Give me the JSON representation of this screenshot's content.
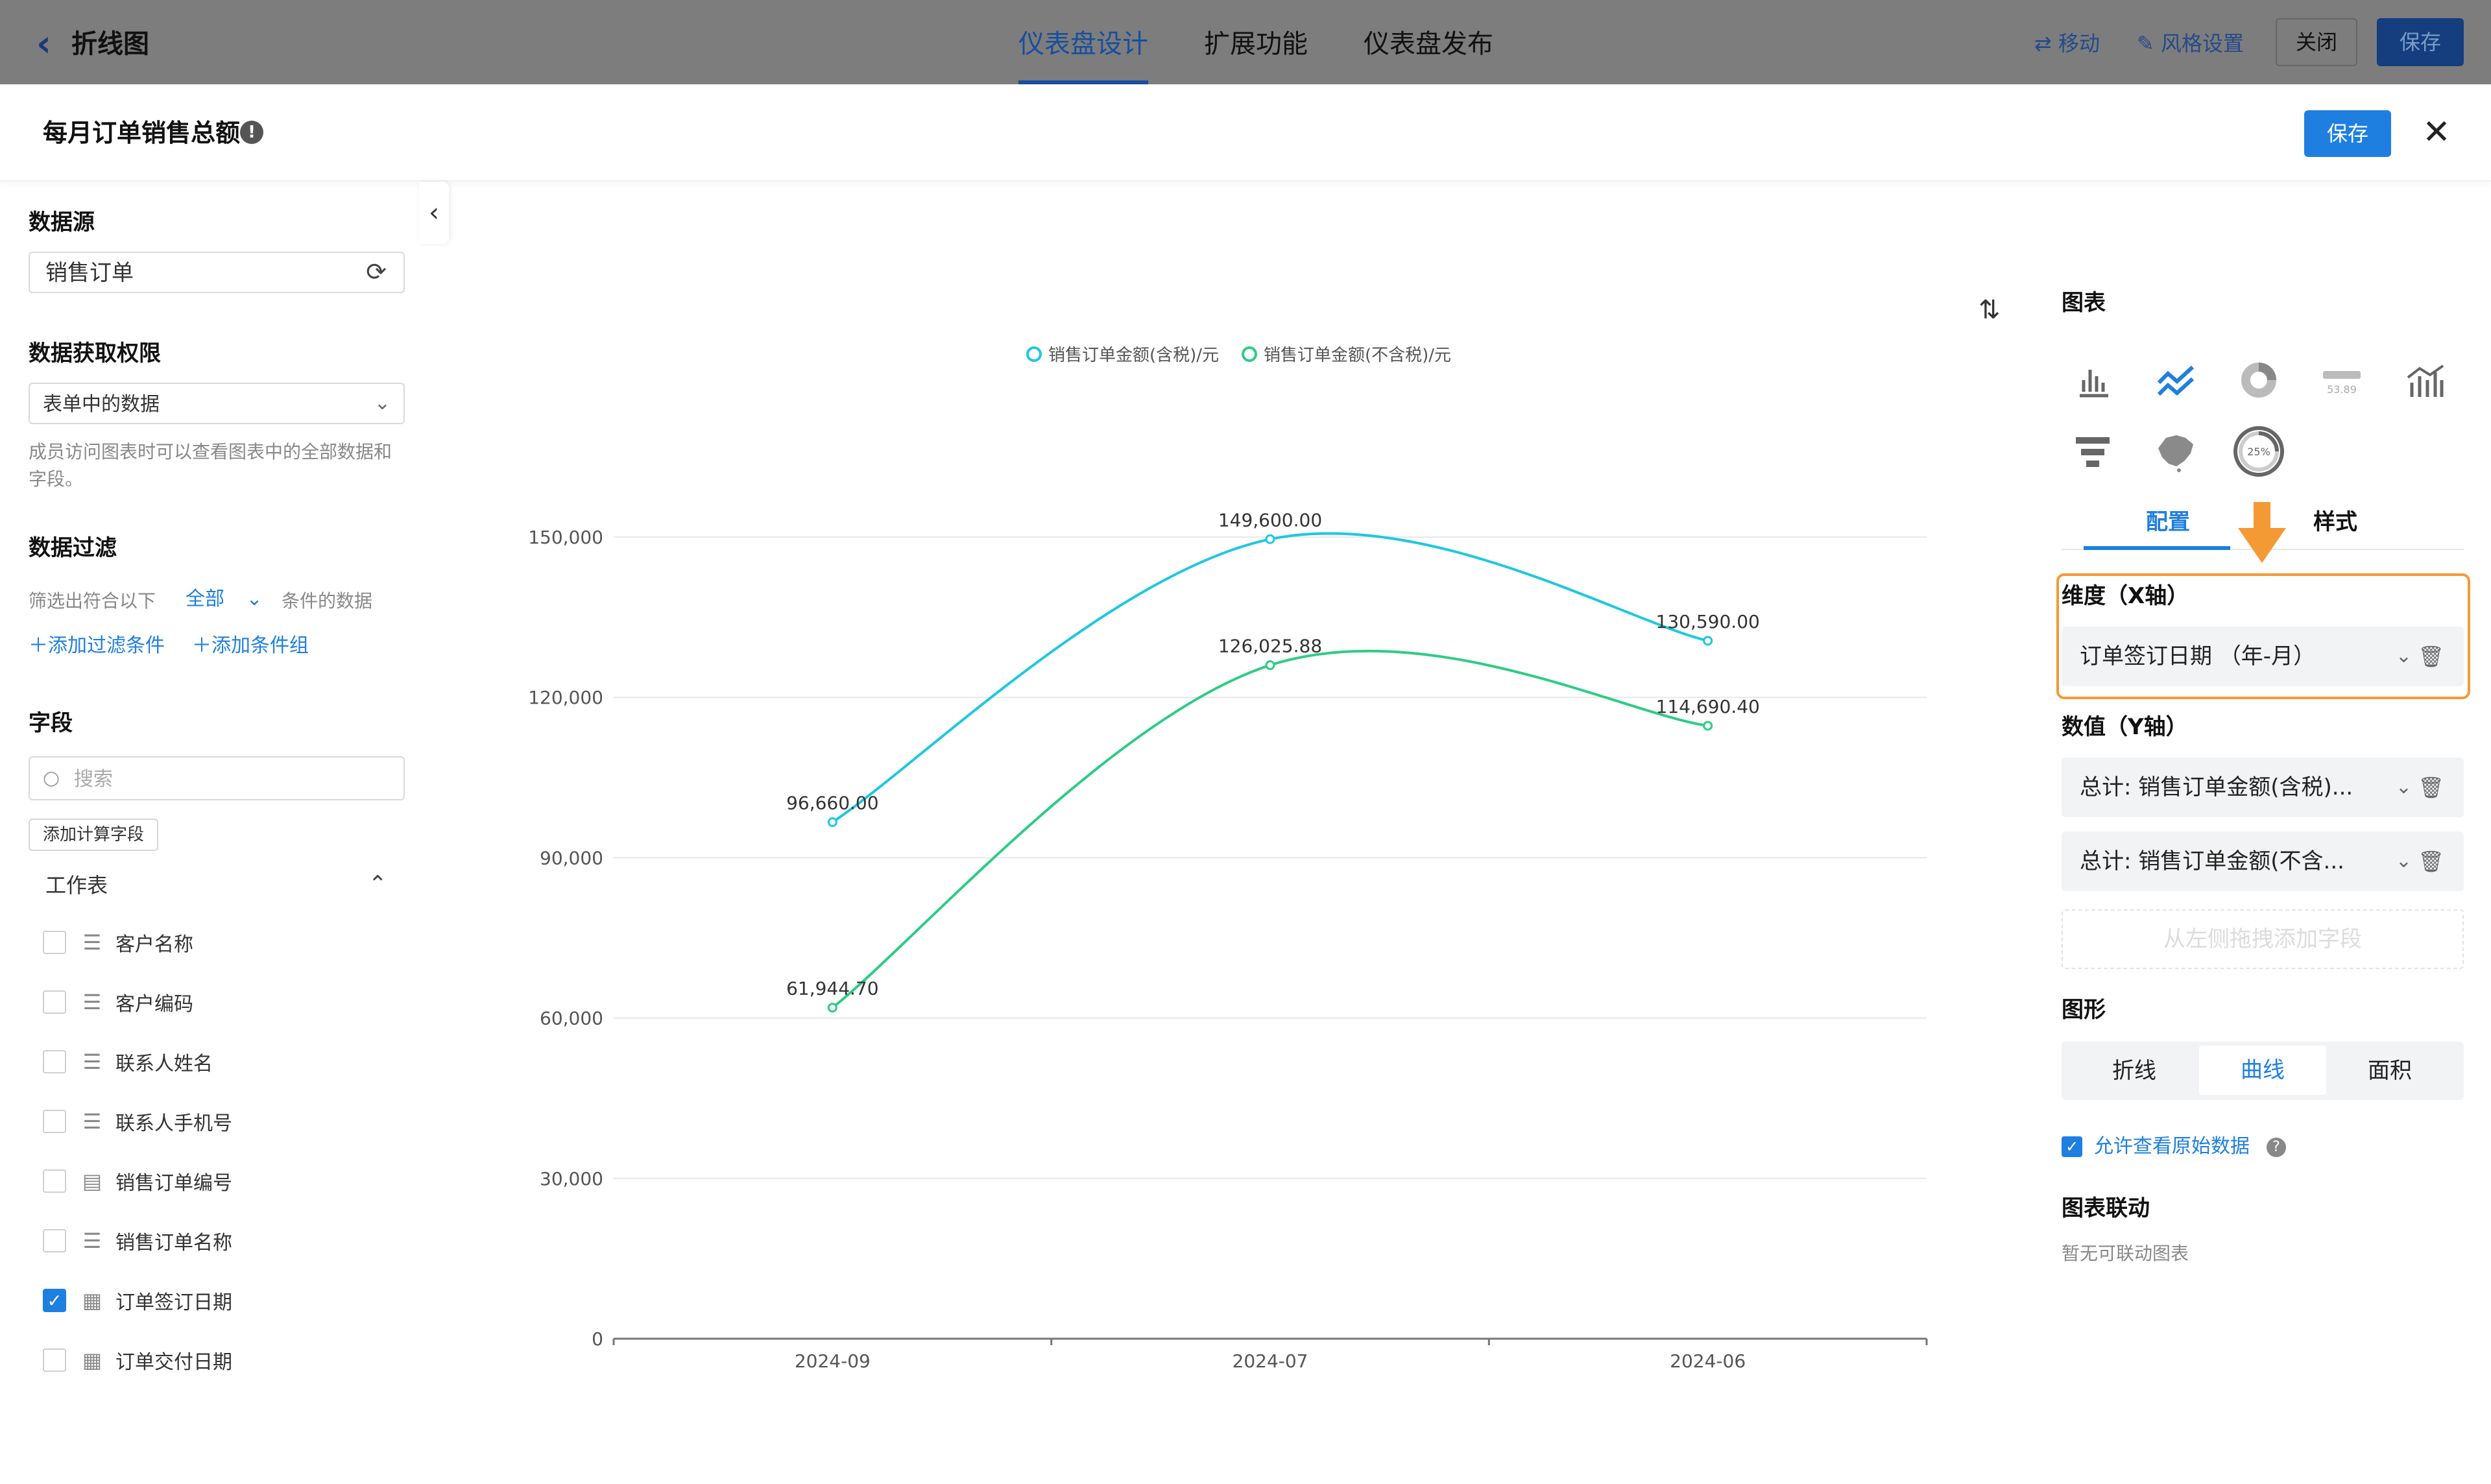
{
  "topbar": {
    "back_title": "折线图",
    "tabs": [
      "仪表盘设计",
      "扩展功能",
      "仪表盘发布"
    ],
    "move": "移动",
    "style_settings": "风格设置",
    "close": "关闭",
    "save": "保存"
  },
  "modal": {
    "title": "每月订单销售总额",
    "save": "保存"
  },
  "left": {
    "datasource_label": "数据源",
    "datasource_value": "销售订单",
    "permission_label": "数据获取权限",
    "permission_value": "表单中的数据",
    "permission_hint": "成员访问图表时可以查看图表中的全部数据和字段。",
    "filter_label": "数据过滤",
    "filter_prefix": "筛选出符合以下",
    "filter_mode": "全部",
    "filter_suffix": "条件的数据",
    "add_condition": "添加过滤条件",
    "add_group": "添加条件组",
    "fields_label": "字段",
    "search_placeholder": "搜索",
    "add_calc_field": "添加计算字段",
    "worksheet": "工作表",
    "fields": [
      {
        "label": "客户名称",
        "icon": "text-icon",
        "checked": false
      },
      {
        "label": "客户编码",
        "icon": "text-icon",
        "checked": false
      },
      {
        "label": "联系人姓名",
        "icon": "text-icon",
        "checked": false
      },
      {
        "label": "联系人手机号",
        "icon": "text-icon",
        "checked": false
      },
      {
        "label": "销售订单编号",
        "icon": "serial-icon",
        "checked": false
      },
      {
        "label": "销售订单名称",
        "icon": "text-icon",
        "checked": false
      },
      {
        "label": "订单签订日期",
        "icon": "calendar-icon",
        "checked": true
      },
      {
        "label": "订单交付日期",
        "icon": "calendar-icon",
        "checked": false
      }
    ]
  },
  "chart_data": {
    "type": "line",
    "smooth": true,
    "categories": [
      "2024-09",
      "2024-07",
      "2024-06"
    ],
    "series": [
      {
        "name": "销售订单金额(含税)/元",
        "color": "#1fc7e0",
        "values": [
          96660.0,
          149600.0,
          130590.0
        ],
        "labels": [
          "96,660.00",
          "149,600.00",
          "130,590.00"
        ]
      },
      {
        "name": "销售订单金额(不含税)/元",
        "color": "#2ecc85",
        "values": [
          61944.7,
          126025.88,
          114690.4
        ],
        "labels": [
          "61,944.70",
          "126,025.88",
          "114,690.40"
        ]
      }
    ],
    "yticks": [
      "0",
      "30,000",
      "60,000",
      "90,000",
      "120,000",
      "150,000"
    ],
    "ylim": [
      0,
      150000
    ],
    "legend": "top-center",
    "grid": true
  },
  "right": {
    "chart_label": "图表",
    "tab_config": "配置",
    "tab_style": "样式",
    "dimension_label": "维度（X轴）",
    "dimension_value": "订单签订日期 （年-月）",
    "value_label": "数值（Y轴）",
    "value1": "总计:  销售订单金额(含税)...",
    "value2": "总计:  销售订单金额(不含...",
    "drop_hint": "从左侧拖拽添加字段",
    "shape_label": "图形",
    "shapes": [
      "折线",
      "曲线",
      "面积"
    ],
    "allow_raw": "允许查看原始数据",
    "linkage_label": "图表联动",
    "linkage_hint": "暂无可联动图表",
    "gauge_text": "25%",
    "number_text": "53.89",
    "accent_color": "#1e7fe0",
    "highlight_color": "#f39a34"
  }
}
